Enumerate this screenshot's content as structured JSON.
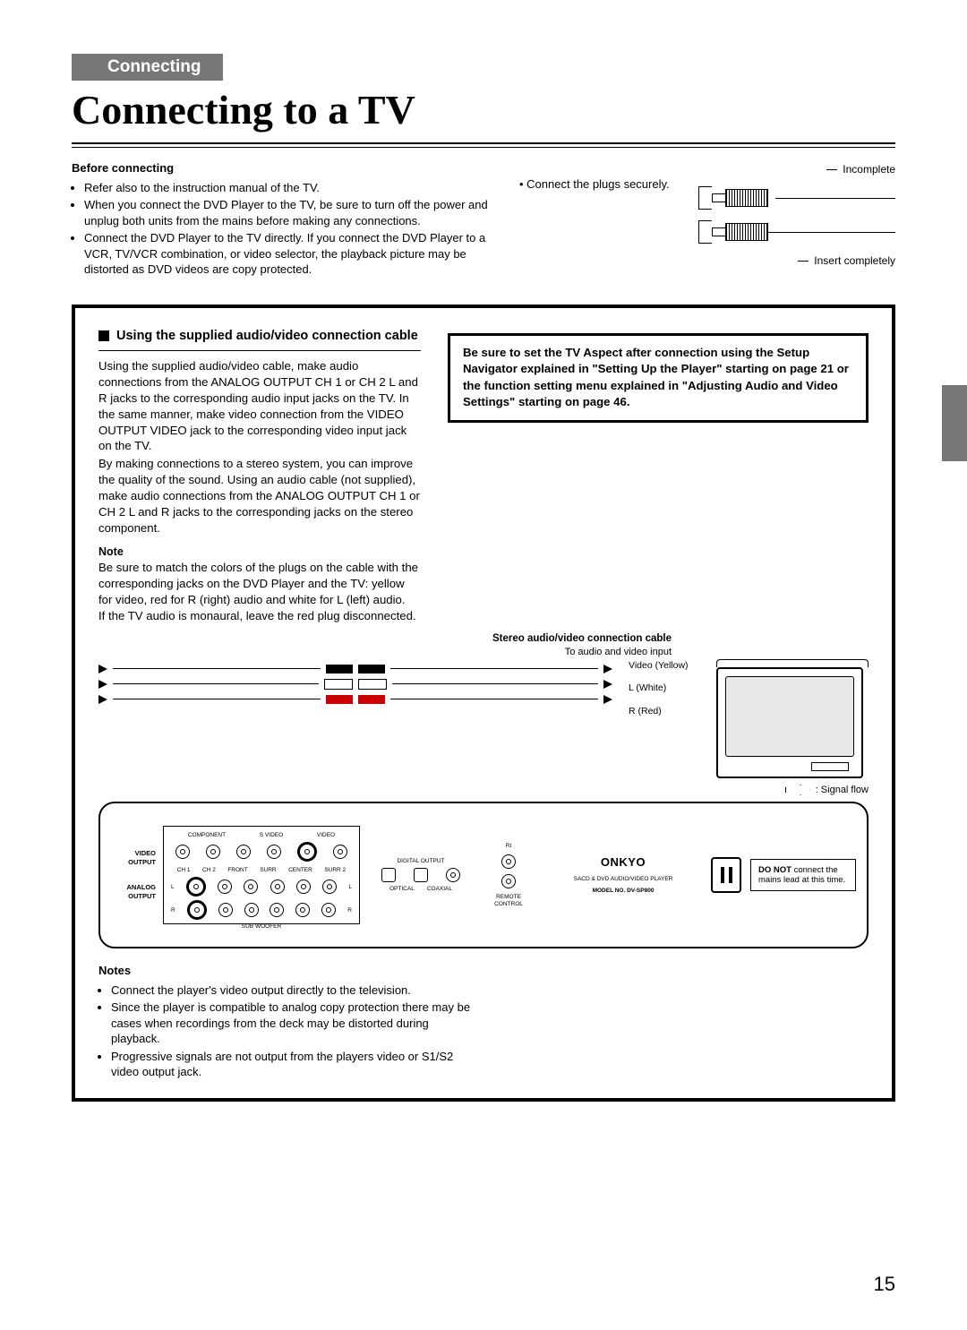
{
  "header": {
    "ribbon": "Connecting",
    "title": "Connecting to a TV"
  },
  "before": {
    "heading": "Before connecting",
    "bullets": [
      "Refer also to the instruction manual of the TV.",
      "When you connect the DVD Player to the TV, be sure to turn off the power and unplug both units from the mains before making any connections.",
      "Connect the DVD Player to the TV directly. If you connect the DVD Player to a VCR, TV/VCR combination, or video selector, the playback picture may be distorted as DVD videos are copy protected."
    ],
    "secure": "Connect the plugs securely.",
    "incomplete": "Incomplete",
    "insert": "Insert completely"
  },
  "section": {
    "heading": "Using the supplied audio/video connection cable",
    "para1": "Using the supplied audio/video cable, make audio connections from the ANALOG OUTPUT CH 1 or CH 2 L and R jacks to the corresponding audio input jacks on the TV. In the same manner, make video connection from the VIDEO OUTPUT VIDEO jack to the corresponding video input jack on the TV.",
    "para2": "By making connections to a stereo system, you can improve the quality of the sound. Using an audio cable (not supplied), make audio connections from the ANALOG OUTPUT CH 1 or CH 2 L and R jacks to the corresponding jacks on the stereo component.",
    "note_hd": "Note",
    "note_body": "Be sure to match the colors of the plugs on the cable with the corresponding jacks on the DVD Player and the TV: yellow for video, red for R (right) audio and white for L (left) audio.\nIf the TV audio is monaural, leave the red plug disconnected.",
    "info_box": "Be sure to set the TV Aspect after connection using the Setup Navigator explained in \"Setting Up the Player\" starting on page 21 or the function setting menu explained in \"Adjusting Audio and Video Settings\" starting on page 46."
  },
  "diagram": {
    "cable_head": "Stereo audio/video connection cable",
    "to_av": "To audio and video input",
    "labels": {
      "video": "Video (Yellow)",
      "l": "L (White)",
      "r": "R (Red)"
    },
    "signal": ": Signal flow",
    "panel": {
      "video_out": "VIDEO OUTPUT",
      "analog_out": "ANALOG OUTPUT",
      "component": "COMPONENT",
      "svideo": "S VIDEO",
      "video": "VIDEO",
      "ch1": "CH 1",
      "ch2": "CH 2",
      "front": "FRONT",
      "surr": "SURR",
      "center": "CENTER",
      "surr2": "SURR 2",
      "sub": "SUB WOOFER",
      "digital": "DIGITAL OUTPUT",
      "optical": "OPTICAL",
      "coaxial": "COAXIAL",
      "remote": "REMOTE CONTROL",
      "ri": "RI",
      "brand": "ONKYO",
      "sub_brand": "SACD & DVD AUDIO/VIDEO PLAYER",
      "model": "MODEL NO. DV-SP800",
      "l": "L",
      "r": "R"
    },
    "mains": {
      "line1_bold": "DO NOT",
      "line1_rest": " connect the mains lead at this time."
    }
  },
  "notes2": {
    "hd": "Notes",
    "items": [
      "Connect the player's video output directly to the television.",
      "Since the player is compatible to analog copy protection there may be cases when recordings from the deck may be distorted during playback.",
      "Progressive signals are not output from the players video or S1/S2 video output jack."
    ]
  },
  "page_number": "15"
}
